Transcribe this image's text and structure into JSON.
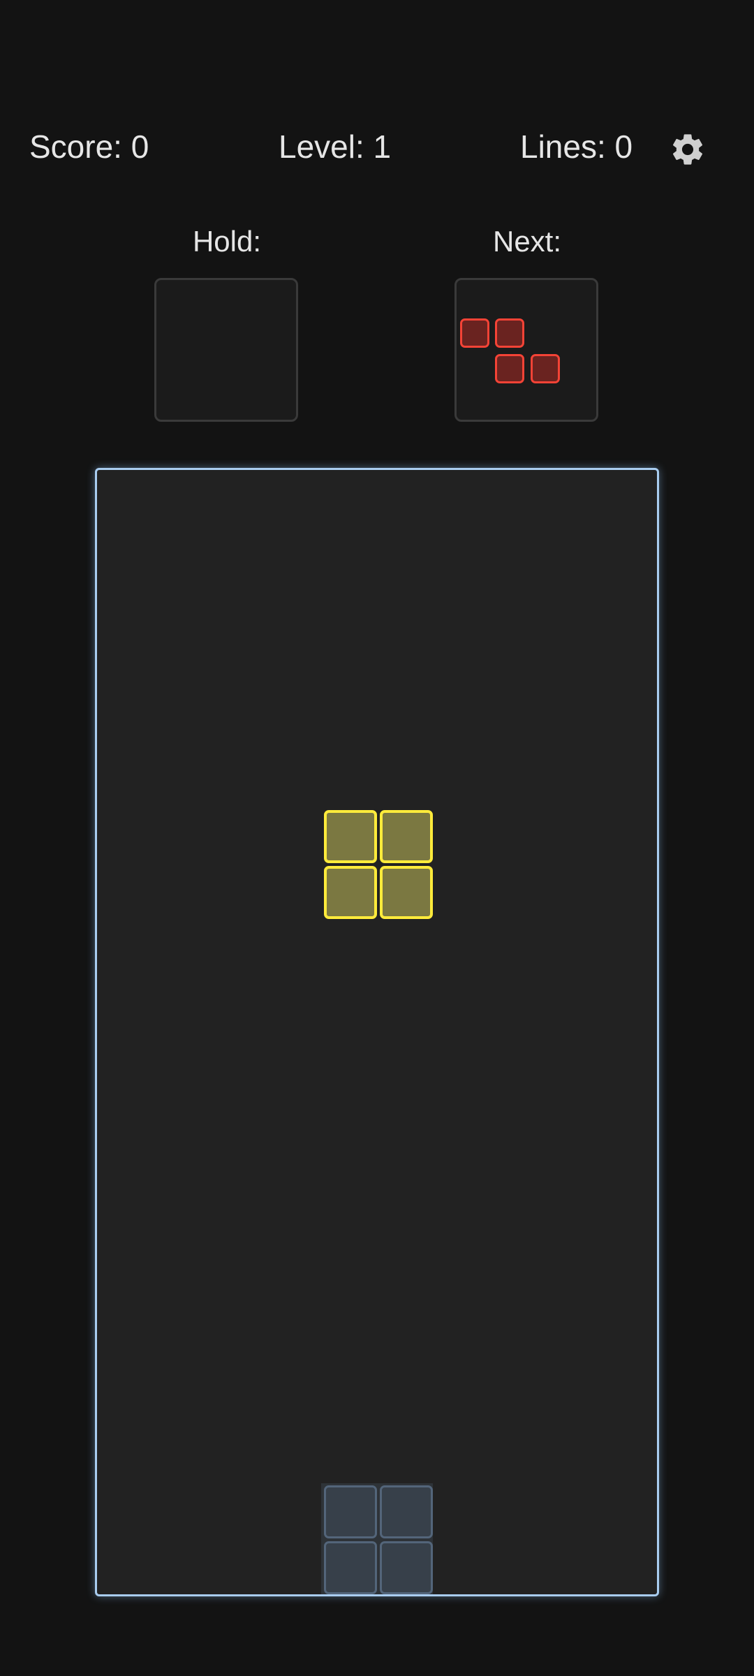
{
  "stats": {
    "score": "Score: 0",
    "level": "Level: 1",
    "lines": "Lines: 0"
  },
  "settings": {
    "icon": "gear-icon",
    "color": "#d0d0d0"
  },
  "hold": {
    "label": "Hold:"
  },
  "next": {
    "label": "Next:",
    "piece": "Z",
    "color": "#f44336"
  },
  "board": {
    "border_color": "#a9cdf0",
    "columns": 10,
    "rows": 20,
    "active_piece": {
      "type": "O",
      "color": "#ffeb3b"
    },
    "ghost_piece": {
      "type": "O",
      "color": "#53657a"
    }
  }
}
